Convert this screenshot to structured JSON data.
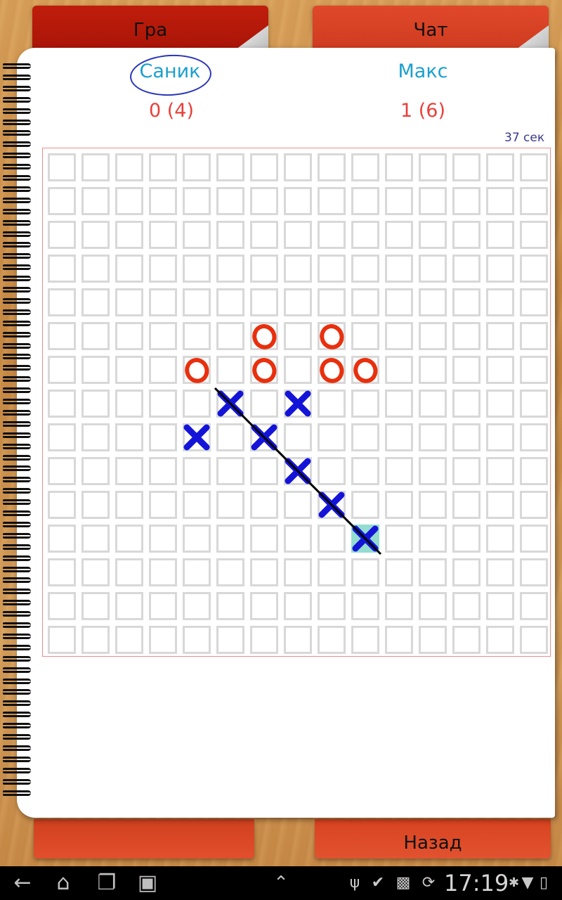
{
  "tabs": {
    "game": "Гра",
    "chat": "Чат",
    "back": "Назад"
  },
  "players": [
    {
      "name": "Саник",
      "score": "0 (4)",
      "active": true
    },
    {
      "name": "Макс",
      "score": "1 (6)",
      "active": false
    }
  ],
  "timer": "37 сек",
  "board": {
    "size": 15,
    "o_cells": [
      [
        6,
        5
      ],
      [
        8,
        5
      ],
      [
        4,
        6
      ],
      [
        6,
        6
      ],
      [
        8,
        6
      ],
      [
        9,
        6
      ]
    ],
    "x_cells": [
      [
        5,
        7
      ],
      [
        7,
        7
      ],
      [
        4,
        8
      ],
      [
        6,
        8
      ],
      [
        7,
        9
      ],
      [
        8,
        10
      ],
      [
        9,
        11
      ]
    ],
    "highlight_cell": [
      9,
      11
    ],
    "win_line": {
      "from": [
        5,
        7
      ],
      "to": [
        9,
        11
      ]
    },
    "colors": {
      "o": "#e8300e",
      "x": "#1414d8",
      "highlight": "#94dccf"
    }
  },
  "status_bar": {
    "time": "17:19",
    "icons": [
      "back-icon",
      "home-icon",
      "recent-apps-icon",
      "screenshot-icon",
      "up-chevron-icon",
      "usb-icon",
      "check-icon",
      "android-icon",
      "sync-icon",
      "bluetooth-icon",
      "wifi-icon",
      "battery-icon"
    ]
  }
}
